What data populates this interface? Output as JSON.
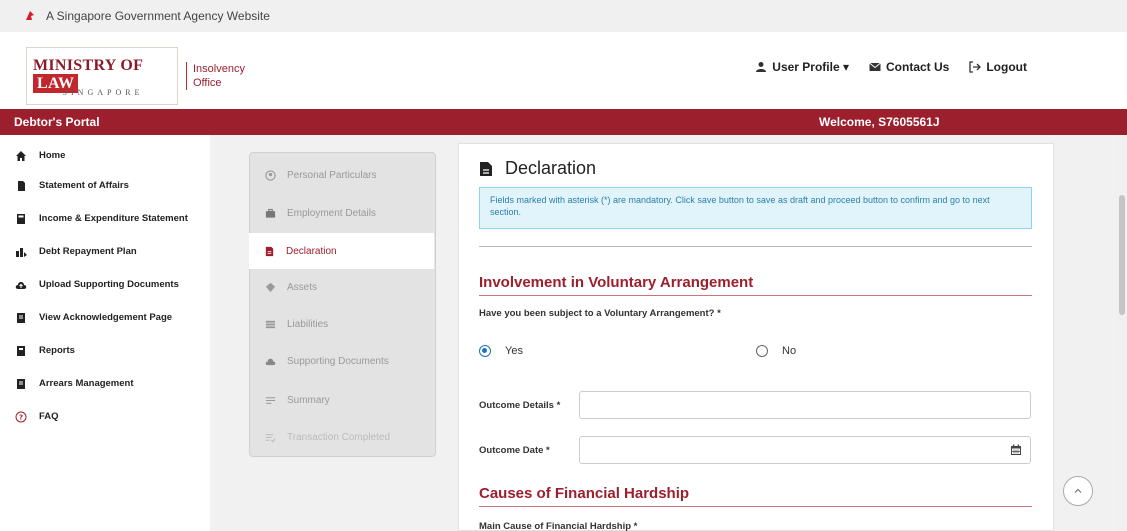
{
  "gov_bar": {
    "text": "A Singapore Government Agency Website"
  },
  "logo": {
    "main_part1": "MINISTRY OF ",
    "main_part2": "LAW",
    "country": "SINGAPORE",
    "sub_line1": "Insolvency",
    "sub_line2": "Office"
  },
  "header_nav": {
    "user_profile": "User Profile ▾",
    "contact_us": "Contact Us",
    "logout": "Logout"
  },
  "portal_bar": {
    "title": "Debtor's Portal",
    "welcome": "Welcome, S7605561J"
  },
  "sidebar": {
    "items": [
      {
        "label": "Home",
        "icon": "home-icon"
      },
      {
        "label": "Statement of Affairs",
        "icon": "file-icon"
      },
      {
        "label": "Income & Expenditure Statement",
        "icon": "calculator-icon"
      },
      {
        "label": "Debt Repayment Plan",
        "icon": "chart-icon"
      },
      {
        "label": "Upload Supporting Documents",
        "icon": "cloud-upload-icon"
      },
      {
        "label": "View Acknowledgement Page",
        "icon": "document-icon"
      },
      {
        "label": "Reports",
        "icon": "book-icon"
      },
      {
        "label": "Arrears Management",
        "icon": "document-icon"
      },
      {
        "label": "FAQ",
        "icon": "question-icon"
      }
    ]
  },
  "steps": {
    "items": [
      {
        "label": "Personal Particulars",
        "icon": "user-icon"
      },
      {
        "label": "Employment Details",
        "icon": "briefcase-icon"
      },
      {
        "label": "Declaration",
        "icon": "file-text-icon",
        "active": true
      },
      {
        "label": "Assets",
        "icon": "gem-icon"
      },
      {
        "label": "Liabilities",
        "icon": "list-icon"
      },
      {
        "label": "Supporting Documents",
        "icon": "cloud-upload-icon"
      },
      {
        "label": "Summary",
        "icon": "lines-icon"
      },
      {
        "label": "Transaction Completed",
        "icon": "lines-check-icon"
      }
    ]
  },
  "main": {
    "title": "Declaration",
    "info": "Fields marked with asterisk (*) are mandatory. Click save button to save as draft and proceed button to confirm and go to next section.",
    "section1_title": "Involvement in Voluntary Arrangement",
    "question": "Have you been subject to a Voluntary Arrangement? *",
    "radio_yes": "Yes",
    "radio_no": "No",
    "outcome_details_label": "Outcome Details *",
    "outcome_date_label": "Outcome Date *",
    "section2_title": "Causes of Financial Hardship",
    "main_cause_label": "Main Cause of Financial Hardship *"
  },
  "colors": {
    "brand": "#9c1f2e",
    "info_bg": "#e2f4fb",
    "info_text": "#2a7fa8",
    "radio_checked": "#1e73be"
  }
}
